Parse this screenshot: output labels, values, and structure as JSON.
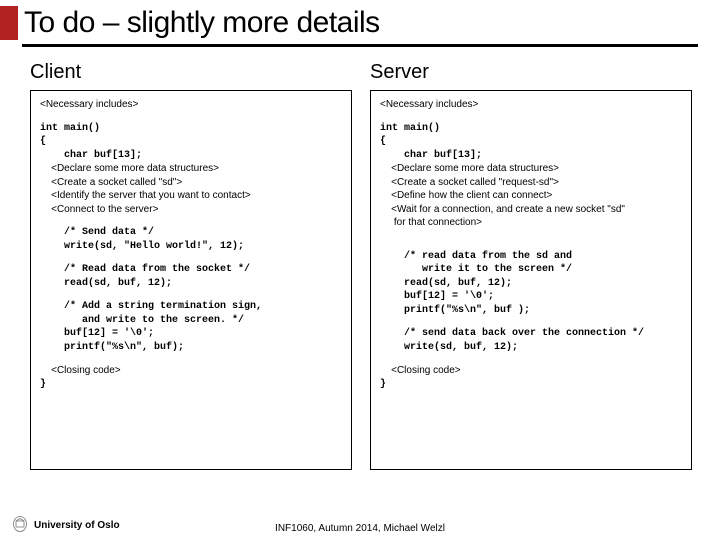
{
  "title": "To do – slightly more details",
  "client": {
    "header": "Client",
    "l1": "<Necessary includes>",
    "l2": "int main()",
    "l3": "{",
    "l4": "    char buf[13];",
    "l5": "    <Declare some more data structures>",
    "l6": "    <Create a socket called \"sd\">",
    "l7": "    <Identify the server that you want to contact>",
    "l8": "    <Connect to the server>",
    "l9": "    /* Send data */",
    "l10": "    write(sd, \"Hello world!\", 12);",
    "l11": "    /* Read data from the socket */",
    "l12": "    read(sd, buf, 12);",
    "l13": "    /* Add a string termination sign,",
    "l14": "       and write to the screen. */",
    "l15": "    buf[12] = '\\0';",
    "l16": "    printf(\"%s\\n\", buf);",
    "l17": "    <Closing code>",
    "l18": "}"
  },
  "server": {
    "header": "Server",
    "l1": "<Necessary includes>",
    "l2": "int main()",
    "l3": "{",
    "l4": "    char buf[13];",
    "l5": "    <Declare some more data structures>",
    "l6": "    <Create a socket called \"request-sd\">",
    "l7": "    <Define how the client can connect>",
    "l8": "    <Wait for a connection, and create a new socket \"sd\"",
    "l9": "     for that connection>",
    "l10": "    /* read data from the sd and",
    "l11": "       write it to the screen */",
    "l12": "    read(sd, buf, 12);",
    "l13": "    buf[12] = '\\0';",
    "l14": "    printf(\"%s\\n\", buf );",
    "l15": "    /* send data back over the connection */",
    "l16": "    write(sd, buf, 12);",
    "l17": "    <Closing code>",
    "l18": "}"
  },
  "footer": {
    "org": "University of Oslo",
    "center": "INF1060, Autumn 2014, Michael Welzl"
  }
}
